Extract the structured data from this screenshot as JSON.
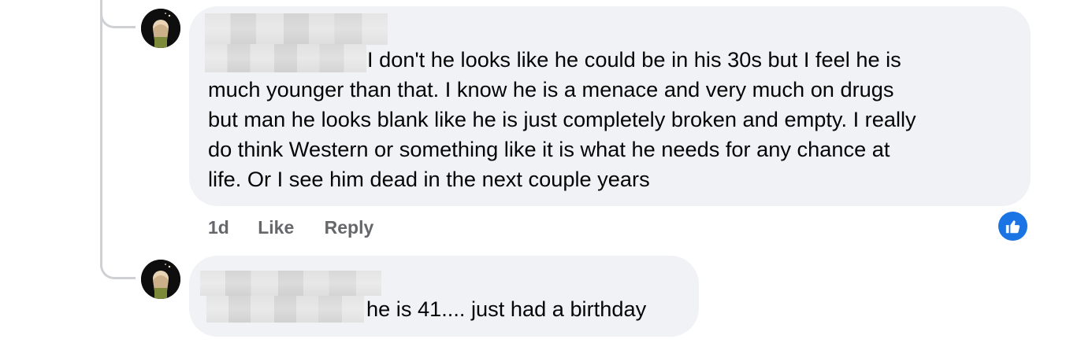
{
  "comments": [
    {
      "text_first_line": "I don't he looks like he could be in his 30s but I feel he is",
      "text_lines": [
        "much younger than that. I know he is a menace and very much on drugs",
        "but man he looks blank like he is just completely broken and empty. I really",
        "do think Western or something like it is what he needs for any chance at",
        "life. Or I see him dead in the next couple years"
      ],
      "timestamp": "1d",
      "like_label": "Like",
      "reply_label": "Reply",
      "reaction_icon": "thumbs-up-icon",
      "reaction_color": "#1b74e4"
    },
    {
      "text_first_line": "he is 41.... just had a birthday"
    }
  ],
  "colors": {
    "bubble": "#f0f2f5",
    "text": "#050505",
    "secondary": "#65676b",
    "thread_line": "#ced0d4"
  }
}
